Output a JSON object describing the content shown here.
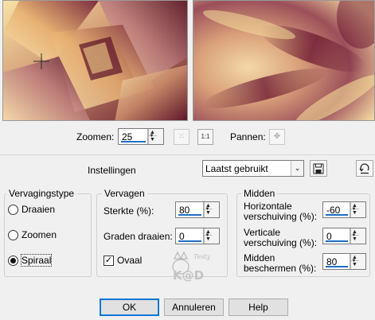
{
  "zoom": {
    "label": "Zoomen:",
    "value": "25"
  },
  "pan": {
    "label": "Pannen:"
  },
  "settings": {
    "label": "Instellingen",
    "preset": "Laatst gebruikt"
  },
  "distortion": {
    "title": "Vervagingstype",
    "options": [
      {
        "label": "Draaien",
        "selected": false
      },
      {
        "label": "Zoomen",
        "selected": false
      },
      {
        "label": "Spiraal",
        "selected": true
      }
    ]
  },
  "blur": {
    "title": "Vervagen",
    "strength_label": "Sterkte (%):",
    "strength_value": "80",
    "rotate_label": "Graden draaien:",
    "rotate_value": "0",
    "oval_label": "Ovaal",
    "oval_checked": true
  },
  "center": {
    "title": "Midden",
    "h_offset_label_1": "Horizontale",
    "h_offset_label_2": "verschuiving (%):",
    "h_offset_value": "-60",
    "v_offset_label_1": "Verticale",
    "v_offset_label_2": "verschuiving (%):",
    "v_offset_value": "0",
    "protect_label_1": "Midden",
    "protect_label_2": "beschermen (%):",
    "protect_value": "80"
  },
  "watermark": {
    "small": "Testy",
    "main": "K@D"
  },
  "buttons": {
    "ok": "OK",
    "cancel": "Annuleren",
    "help": "Help"
  },
  "colors": {
    "accent": "#1e6fc4",
    "dark_maroon": "#6a1430",
    "cream": "#f6dd9a",
    "gold": "#e3a84c"
  }
}
